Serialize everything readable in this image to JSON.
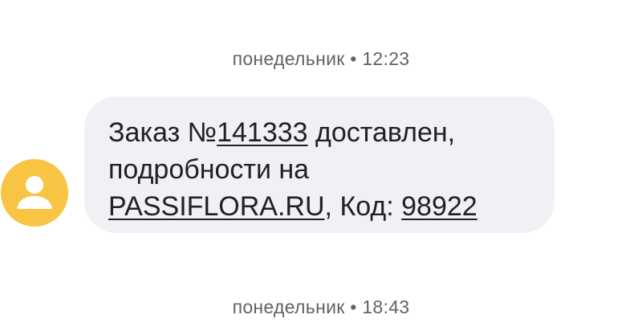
{
  "conversation": {
    "timestamps": [
      {
        "day": "понедельник",
        "separator": "•",
        "time": "12:23"
      },
      {
        "day": "понедельник",
        "separator": "•",
        "time": "18:43"
      }
    ]
  },
  "message": {
    "line1_prefix": "Заказ №",
    "order_number": "141333",
    "line1_suffix": " доставлен,",
    "line2": "подробности на",
    "site_link": "PASSIFLORA.RU",
    "code_prefix": ", Код: ",
    "code": "98922"
  },
  "avatar": {
    "icon": "person-icon",
    "color": "#f7c543"
  },
  "colors": {
    "bubble": "#f0f1f5",
    "text": "#202124",
    "timestamp": "#5f6368"
  }
}
